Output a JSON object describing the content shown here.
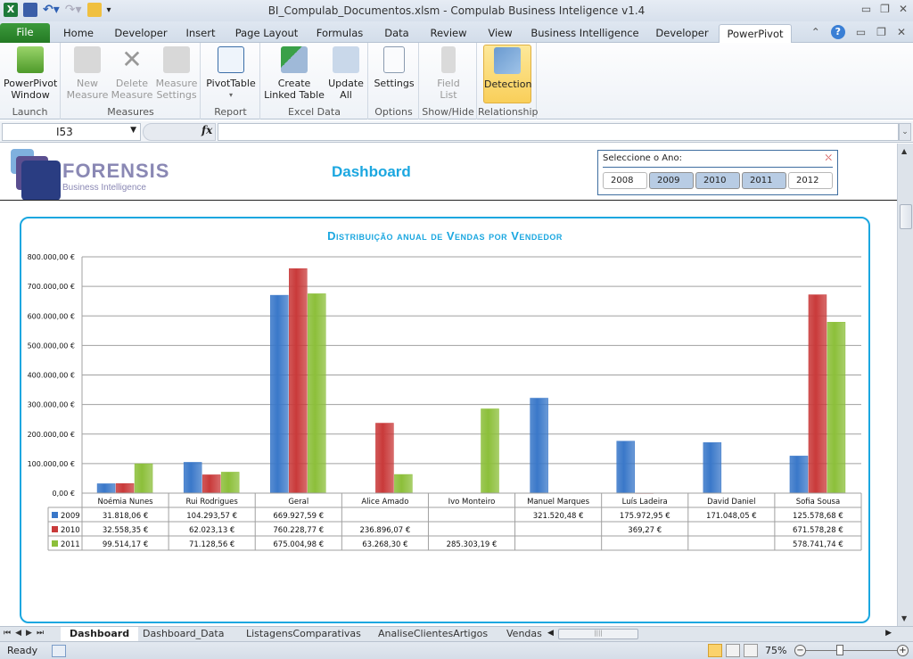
{
  "window": {
    "title": "BI_Compulab_Documentos.xlsm  -  Compulab Business Inteligence v1.4",
    "controls": [
      "minimize",
      "restore",
      "close"
    ]
  },
  "quick_access": [
    "excel-logo-icon",
    "save-icon",
    "undo-icon",
    "redo-icon",
    "open-icon",
    "customize-icon"
  ],
  "tabs": [
    {
      "label": "File"
    },
    {
      "label": "Home"
    },
    {
      "label": "Developer"
    },
    {
      "label": "Insert"
    },
    {
      "label": "Page Layout"
    },
    {
      "label": "Formulas"
    },
    {
      "label": "Data"
    },
    {
      "label": "Review"
    },
    {
      "label": "View"
    },
    {
      "label": "Business Intelligence"
    },
    {
      "label": "Developer"
    },
    {
      "label": "PowerPivot",
      "active": true
    }
  ],
  "ribbon": {
    "groups": [
      {
        "label": "Launch",
        "buttons": [
          {
            "label1": "PowerPivot",
            "label2": "Window",
            "enabled": true
          }
        ]
      },
      {
        "label": "Measures",
        "buttons": [
          {
            "label1": "New",
            "label2": "Measure",
            "enabled": false
          },
          {
            "label1": "Delete",
            "label2": "Measure",
            "enabled": false
          },
          {
            "label1": "Measure",
            "label2": "Settings",
            "enabled": false
          }
        ]
      },
      {
        "label": "Report",
        "buttons": [
          {
            "label1": "PivotTable",
            "label2": "▾",
            "enabled": true
          }
        ]
      },
      {
        "label": "Excel Data",
        "buttons": [
          {
            "label1": "Create",
            "label2": "Linked Table",
            "enabled": true
          },
          {
            "label1": "Update",
            "label2": "All",
            "enabled": true
          }
        ]
      },
      {
        "label": "Options",
        "buttons": [
          {
            "label1": "Settings",
            "label2": "",
            "enabled": true
          }
        ]
      },
      {
        "label": "Show/Hide",
        "buttons": [
          {
            "label1": "Field",
            "label2": "List",
            "enabled": false
          }
        ]
      },
      {
        "label": "Relationship",
        "buttons": [
          {
            "label1": "Detection",
            "label2": "",
            "enabled": true,
            "selected": true
          }
        ]
      }
    ]
  },
  "formula_bar": {
    "name_box": "I53",
    "fx": "fx",
    "formula": ""
  },
  "dashboard": {
    "logo_name": "FORENSIS",
    "logo_sub": "Business Intelligence",
    "title": "Dashboard",
    "slicer": {
      "header": "Seleccione o Ano:",
      "years": [
        {
          "label": "2008",
          "selected": false
        },
        {
          "label": "2009",
          "selected": true
        },
        {
          "label": "2010",
          "selected": true
        },
        {
          "label": "2011",
          "selected": true
        },
        {
          "label": "2012",
          "selected": false
        }
      ]
    }
  },
  "colors": {
    "accent": "#1ba7e0",
    "s2009": "#3a78c9",
    "s2010": "#c93a3a",
    "s2011": "#8cbf3a"
  },
  "chart_data": {
    "type": "bar",
    "title": "Distribuição anual de Vendas por Vendedor",
    "xlabel": "",
    "ylabel": "",
    "ylim": [
      0,
      800000
    ],
    "yticks": [
      0,
      100000,
      200000,
      300000,
      400000,
      500000,
      600000,
      700000,
      800000
    ],
    "ytick_labels": [
      "0,00 €",
      "100.000,00 €",
      "200.000,00 €",
      "300.000,00 €",
      "400.000,00 €",
      "500.000,00 €",
      "600.000,00 €",
      "700.000,00 €",
      "800.000,00 €"
    ],
    "grid": true,
    "legend": "data-table",
    "categories": [
      "Noémia Nunes",
      "Rui Rodrigues",
      "Geral",
      "Alice Amado",
      "Ivo Monteiro",
      "Manuel Marques",
      "Luís Ladeira",
      "David Daniel",
      "Sofia Sousa"
    ],
    "series": [
      {
        "name": "2009",
        "values": [
          31818.06,
          104293.57,
          669927.59,
          null,
          null,
          321520.48,
          175972.95,
          171048.05,
          125578.68
        ],
        "labels": [
          "31.818,06 €",
          "104.293,57 €",
          "669.927,59 €",
          "",
          "",
          "321.520,48 €",
          "175.972,95 €",
          "171.048,05 €",
          "125.578,68 €"
        ]
      },
      {
        "name": "2010",
        "values": [
          32558.35,
          62023.13,
          760228.77,
          236896.07,
          null,
          null,
          369.27,
          null,
          671578.28
        ],
        "labels": [
          "32.558,35 €",
          "62.023,13 €",
          "760.228,77 €",
          "236.896,07 €",
          "",
          "",
          "369,27 €",
          "",
          "671.578,28 €"
        ]
      },
      {
        "name": "2011",
        "values": [
          99514.17,
          71128.56,
          675004.98,
          63268.3,
          285303.19,
          null,
          null,
          null,
          578741.74
        ],
        "labels": [
          "99.514,17 €",
          "71.128,56 €",
          "675.004,98 €",
          "63.268,30 €",
          "285.303,19 €",
          "",
          "",
          "",
          "578.741,74 €"
        ]
      }
    ]
  },
  "sheet_tabs": [
    {
      "label": "Dashboard",
      "active": true
    },
    {
      "label": "Dashboard_Data"
    },
    {
      "label": "ListagensComparativas"
    },
    {
      "label": "AnaliseClientesArtigos"
    },
    {
      "label": "Vendas"
    }
  ],
  "status": {
    "text": "Ready",
    "zoom": "75%",
    "zoom_level": 0.75
  }
}
